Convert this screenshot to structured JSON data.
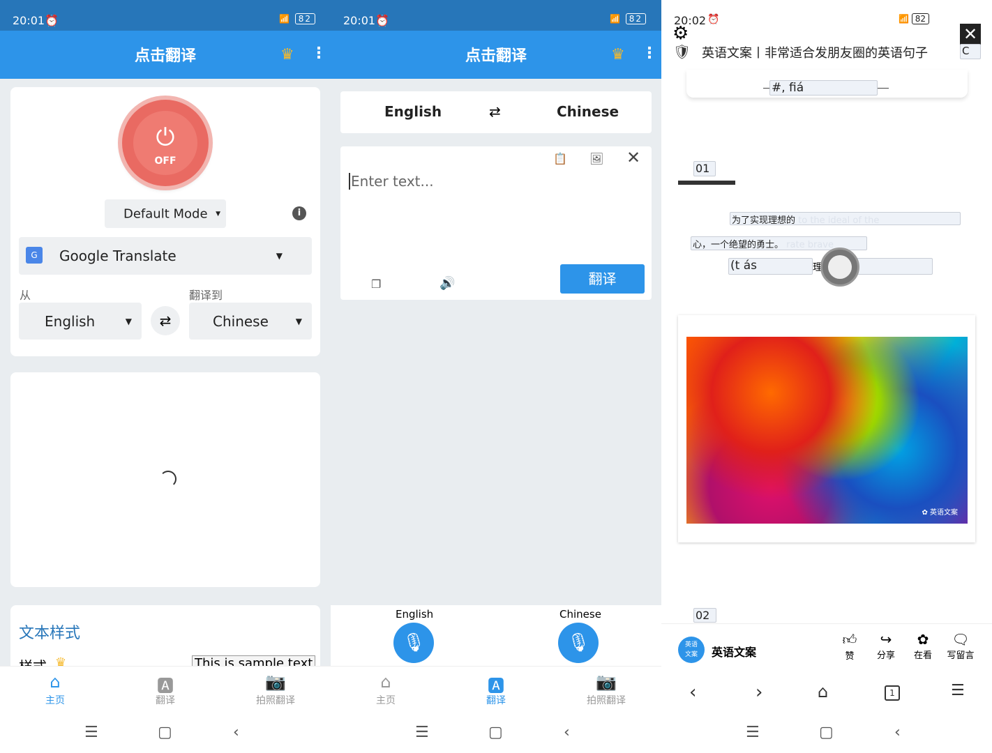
{
  "panel1": {
    "status": {
      "time": "20:01",
      "battery": "82"
    },
    "appbar": {
      "title": "点击翻译"
    },
    "power": {
      "state": "OFF"
    },
    "mode": "Default Mode",
    "engine": "Google Translate",
    "from_label": "从",
    "to_label": "翻译到",
    "from_lang": "English",
    "to_lang": "Chinese",
    "style_card": {
      "title": "文本样式",
      "style_label": "样式",
      "sample": "This is sample text"
    },
    "nav": [
      "主页",
      "翻译",
      "拍照翻译"
    ]
  },
  "panel2": {
    "status": {
      "time": "20:01",
      "battery": "82"
    },
    "appbar": {
      "title": "点击翻译"
    },
    "from_lang": "English",
    "to_lang": "Chinese",
    "input_placeholder": "Enter text...",
    "translate_button": "翻译",
    "mic_left": "English",
    "mic_right": "Chinese",
    "nav": [
      "主页",
      "翻译",
      "拍照翻译"
    ]
  },
  "panel3": {
    "status": {
      "time": "20:02",
      "battery": "82"
    },
    "article_title": "英语文案丨非常适合发朋友圈的英语句子",
    "close_label": "C",
    "overlay_top": "#, fiá",
    "section1": "01",
    "line1": "为了实现理想的",
    "line1_ghost": "to the ideal of the",
    "line2": "心，一个绝望的勇士。",
    "line2_ghost": "rate brave",
    "line3a": "(t ás",
    "line3b": "理想",
    "line3c": ")",
    "watermark": "英语文案",
    "section2": "02",
    "account": "英语文案",
    "account_avatar": "英语文案",
    "actions": [
      "赞",
      "分享",
      "在看",
      "写留言"
    ],
    "tab_count": "1"
  }
}
